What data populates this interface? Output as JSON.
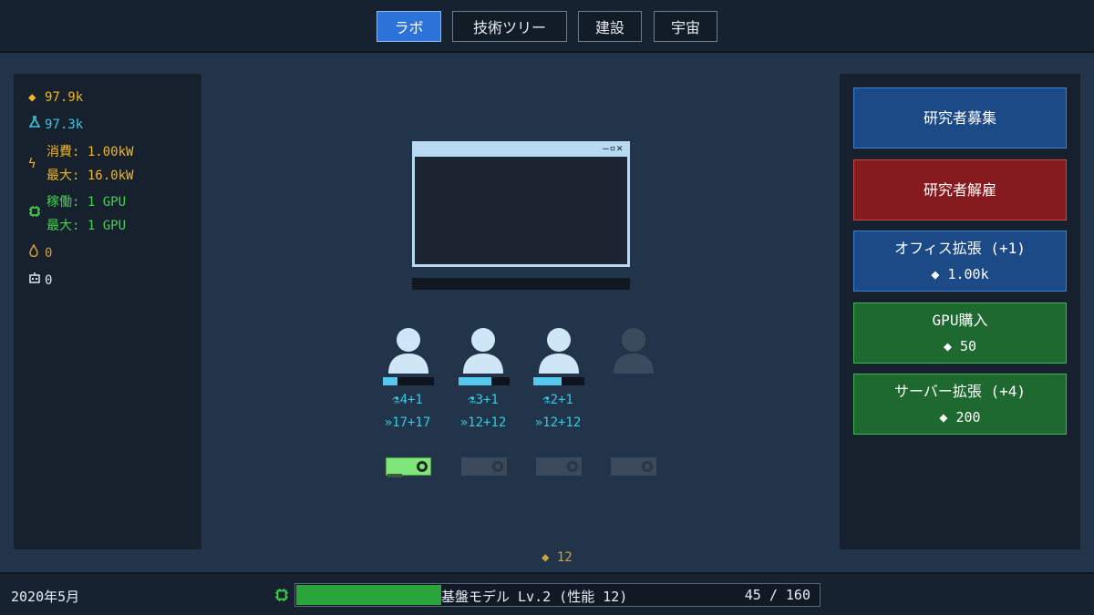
{
  "tabs": [
    {
      "label": "ラボ",
      "active": true
    },
    {
      "label": "技術ツリー",
      "active": false
    },
    {
      "label": "建設",
      "active": false
    },
    {
      "label": "宇宙",
      "active": false
    }
  ],
  "stats": {
    "money": "97.9k",
    "science": "97.3k",
    "power_used": "消費: 1.00kW",
    "power_max": "最大: 16.0kW",
    "gpu_active": "稼働: 1 GPU",
    "gpu_max": "最大: 1 GPU",
    "water": "0",
    "robots": "0"
  },
  "actions": {
    "hire": "研究者募集",
    "fire": "研究者解雇",
    "office_expand": "オフィス拡張 (+1)",
    "office_cost": "◆ 1.00k",
    "gpu_buy": "GPU購入",
    "gpu_cost": "◆ 50",
    "server_expand": "サーバー拡張 (+4)",
    "server_cost": "◆ 200"
  },
  "researchers": [
    {
      "science": "4+1",
      "speed": "17+17",
      "progress": 0.28
    },
    {
      "science": "3+1",
      "speed": "12+12",
      "progress": 0.65
    },
    {
      "science": "2+1",
      "speed": "12+12",
      "progress": 0.55
    }
  ],
  "coins_on_floor": "◆ 12",
  "bottom": {
    "date": "2020年5月",
    "model_label": "基盤モデル Lv.2 (性能 12)",
    "model_count": "45 / 160",
    "model_progress": 0.28
  },
  "colors": {
    "accent_blue": "#2b73d9",
    "money": "#f3b61d",
    "science": "#36c9e3",
    "gpu": "#3fd44a"
  }
}
